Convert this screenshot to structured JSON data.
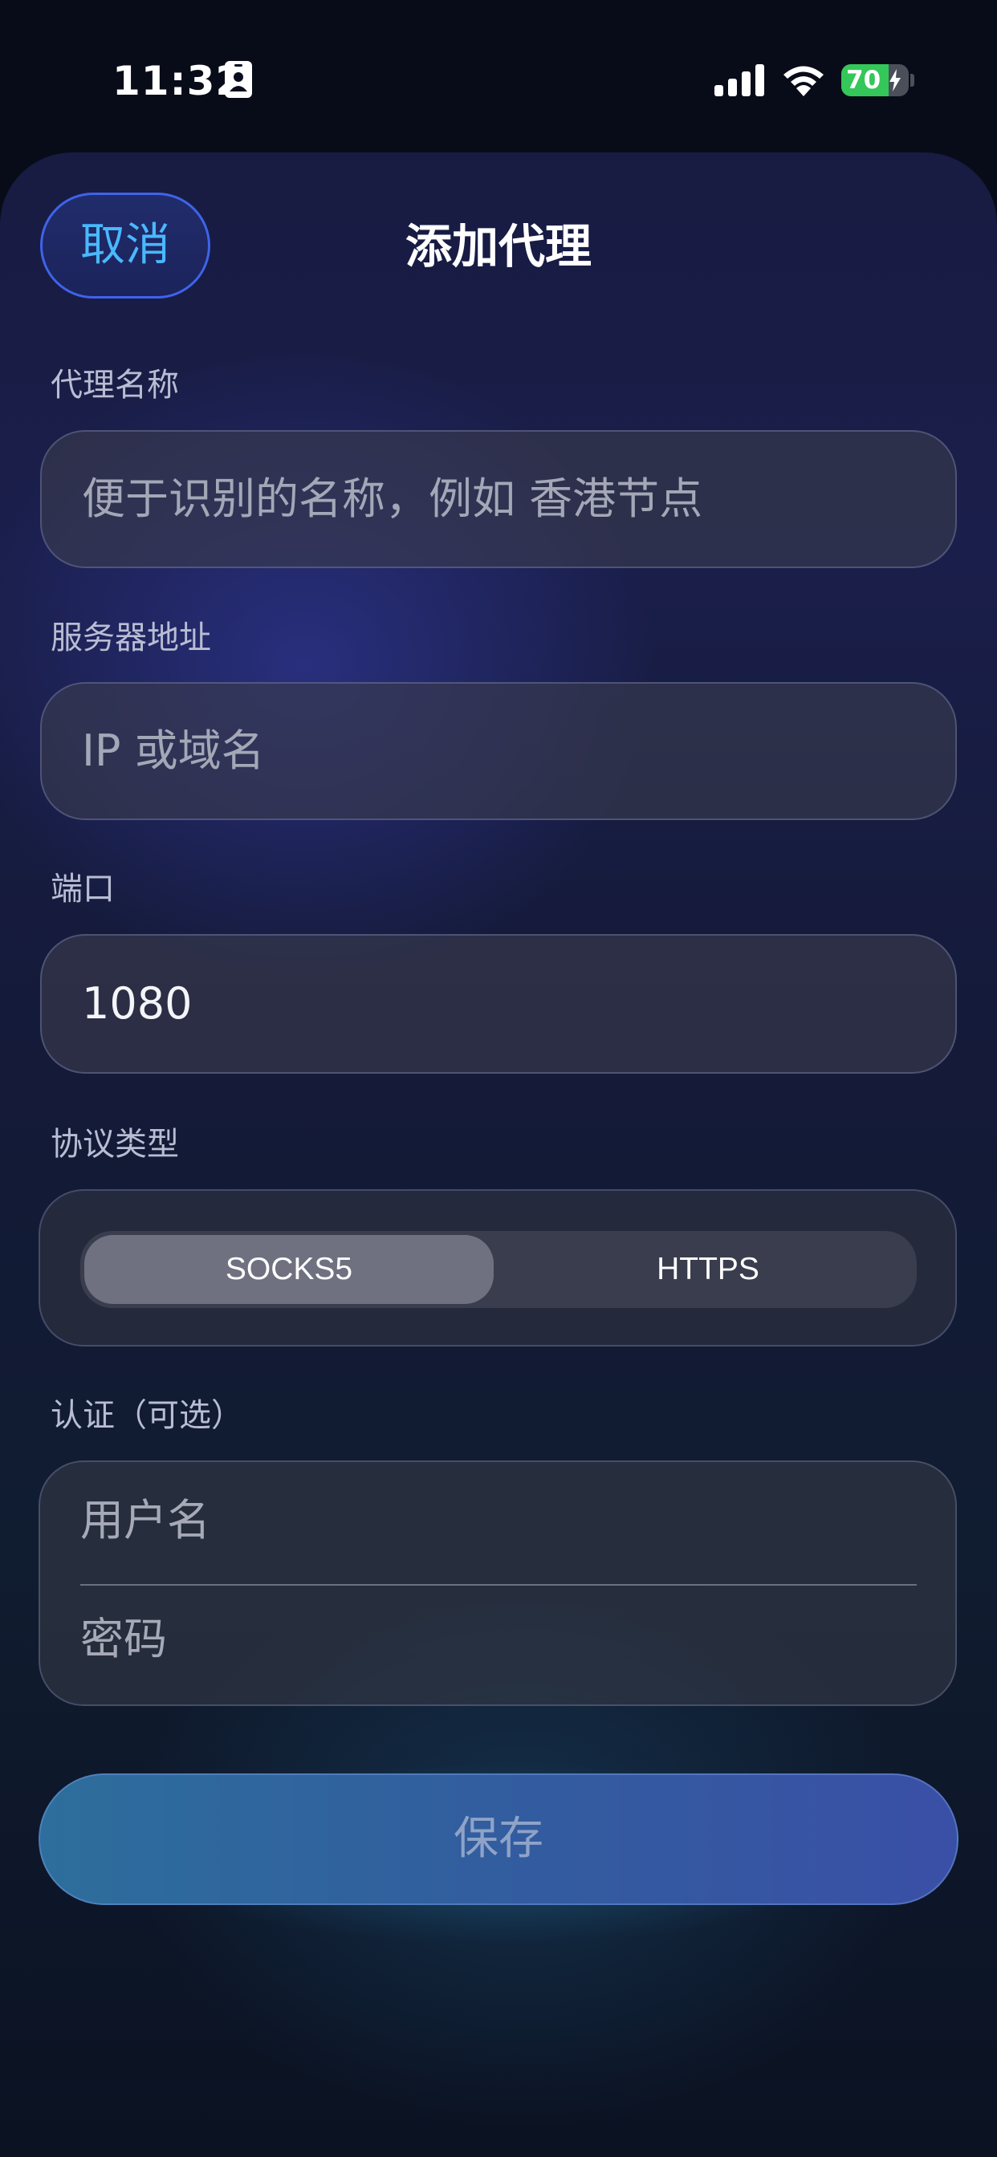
{
  "status_bar": {
    "time": "11:32",
    "battery_percent": "70",
    "battery_level": 0.7
  },
  "icons": {
    "id_card": "id-card-icon",
    "signal": "cellular-signal-icon",
    "wifi": "wifi-icon",
    "battery": "battery-charging-icon",
    "bolt": "lightning-bolt-icon"
  },
  "header": {
    "cancel_label": "取消",
    "title": "添加代理"
  },
  "form": {
    "name": {
      "label": "代理名称",
      "placeholder": "便于识别的名称，例如 香港节点"
    },
    "server": {
      "label": "服务器地址",
      "placeholder": "IP 或域名"
    },
    "port": {
      "label": "端口",
      "value": "1080"
    },
    "protocol": {
      "label": "协议类型",
      "options": [
        "SOCKS5",
        "HTTPS"
      ],
      "selected": "SOCKS5"
    },
    "auth": {
      "label": "认证（可选）",
      "username_placeholder": "用户名",
      "password_placeholder": "密码"
    }
  },
  "actions": {
    "save_label": "保存"
  },
  "colors": {
    "accent": "#49b8ff",
    "cancel_border": "#3f63ea",
    "battery_green": "#34c759",
    "save_gradient_start": "#2d6e9c",
    "save_gradient_end": "#3a4fa6"
  }
}
